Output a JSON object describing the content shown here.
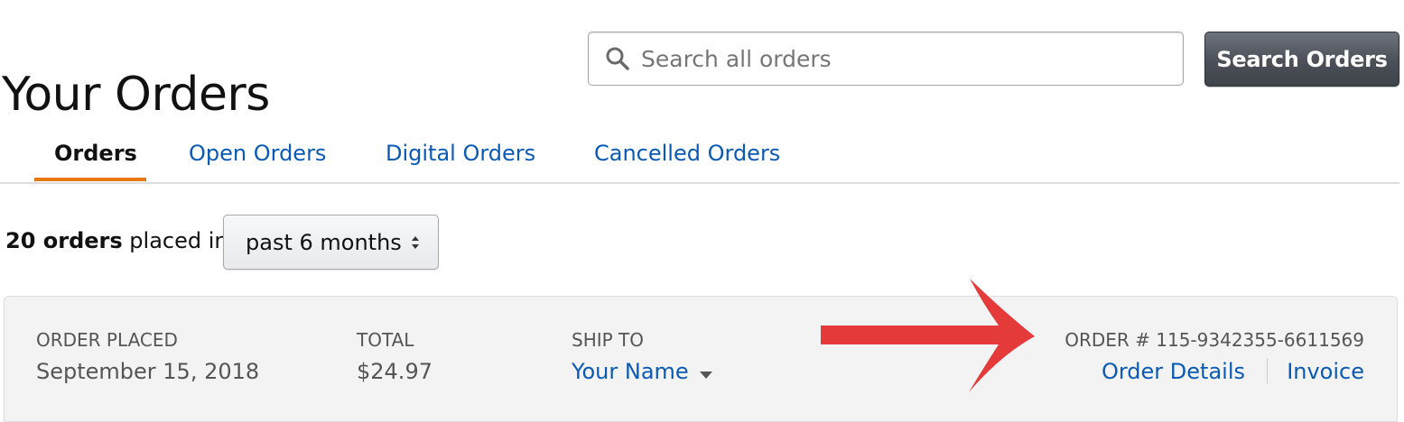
{
  "header": {
    "title": "Your Orders",
    "search": {
      "placeholder": "Search all orders",
      "value": "",
      "icon": "search-icon"
    },
    "search_button_label": "Search Orders"
  },
  "tabs": [
    {
      "label": "Orders",
      "active": true
    },
    {
      "label": "Open Orders",
      "active": false
    },
    {
      "label": "Digital Orders",
      "active": false
    },
    {
      "label": "Cancelled Orders",
      "active": false
    }
  ],
  "summary": {
    "count_text": "20 orders",
    "suffix_text": " placed in",
    "period_selected": "past 6 months"
  },
  "order": {
    "placed_label": "ORDER PLACED",
    "placed_value": "September 15, 2018",
    "total_label": "TOTAL",
    "total_value": "$24.97",
    "ship_to_label": "SHIP TO",
    "ship_to_value": "Your Name",
    "order_number_text": "ORDER # 115-9342355-6611569",
    "order_details_label": "Order Details",
    "invoice_label": "Invoice"
  },
  "colors": {
    "link": "#0a5ab5",
    "tab_active_underline": "#e47911",
    "search_button": "#4b5058",
    "order_header_bg": "#f3f3f3",
    "annotation_arrow": "#e43a3a"
  }
}
